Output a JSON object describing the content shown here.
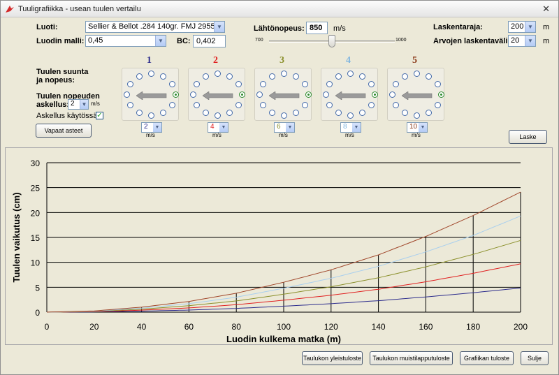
{
  "window": {
    "title": "Tuuligrafiikka - usean tuulen vertailu",
    "close": "✕"
  },
  "bullet": {
    "label": "Luoti:",
    "value": "Sellier & Bellot .284 140gr. FMJ  2955"
  },
  "model": {
    "label": "Luodin malli:",
    "value": "0,45"
  },
  "bc": {
    "label": "BC:",
    "value": "0,402"
  },
  "velocity": {
    "label": "Lähtönopeus:",
    "value": "850",
    "unit": "m/s",
    "min_label": "700",
    "max_label": "1000",
    "slider_fraction": 0.5
  },
  "calc_limit": {
    "label": "Laskentaraja:",
    "value": "200",
    "unit": "m"
  },
  "calc_step": {
    "label": "Arvojen laskentaväli:",
    "value": "20",
    "unit": "m"
  },
  "wind_dir_label_1": "Tuulen suunta",
  "wind_dir_label_2": "ja nopeus:",
  "step_label_1": "Tuulen nopeuden",
  "step_label_2": "askellus:",
  "step": {
    "value": "2",
    "unit": "m/s"
  },
  "step_enabled": {
    "label": "Askellus käytössä:",
    "checked": "✓"
  },
  "free_degrees_button": "Vapaat asteet",
  "calc_button": "Laske",
  "winds": [
    {
      "num": "1",
      "color": "#2b2b8c",
      "speed": "2",
      "unit": "m/s"
    },
    {
      "num": "2",
      "color": "#e02020",
      "speed": "4",
      "unit": "m/s"
    },
    {
      "num": "3",
      "color": "#8a8f2a",
      "speed": "6",
      "unit": "m/s"
    },
    {
      "num": "4",
      "color": "#7fb5e0",
      "speed": "8",
      "unit": "m/s"
    },
    {
      "num": "5",
      "color": "#8b3a1a",
      "speed": "10",
      "unit": "m/s"
    }
  ],
  "chart_data": {
    "type": "line",
    "ylabel": "Tuulen vaikutus (cm)",
    "xlabel": "Luodin kulkema matka (m)",
    "xlim": [
      0,
      200
    ],
    "ylim": [
      0,
      30
    ],
    "xticks": [
      0,
      20,
      40,
      60,
      80,
      100,
      120,
      140,
      160,
      180,
      200
    ],
    "yticks": [
      0,
      5,
      10,
      15,
      20,
      25,
      30
    ],
    "x": [
      0,
      20,
      40,
      60,
      80,
      100,
      120,
      140,
      160,
      180,
      200
    ],
    "series": [
      {
        "color": "#2b2b8c",
        "values": [
          0,
          0.05,
          0.2,
          0.42,
          0.75,
          1.2,
          1.7,
          2.3,
          3.05,
          3.9,
          4.85
        ]
      },
      {
        "color": "#e02020",
        "values": [
          0,
          0.1,
          0.4,
          0.85,
          1.5,
          2.4,
          3.4,
          4.6,
          6.1,
          7.8,
          9.7
        ]
      },
      {
        "color": "#8a8f2a",
        "values": [
          0,
          0.15,
          0.6,
          1.3,
          2.25,
          3.6,
          5.1,
          6.9,
          9.1,
          11.6,
          14.4
        ]
      },
      {
        "color": "#a9cfee",
        "values": [
          0,
          0.2,
          0.8,
          1.7,
          3.0,
          4.8,
          6.8,
          9.2,
          12.1,
          15.4,
          19.3
        ]
      },
      {
        "color": "#a0462a",
        "values": [
          0,
          0.25,
          1.0,
          2.15,
          3.8,
          6.0,
          8.5,
          11.5,
          15.2,
          19.4,
          24.1
        ]
      }
    ],
    "grid": "horizontal"
  },
  "bottom_buttons": [
    "Taulukon yleistuloste",
    "Taulukon muistilapputuloste",
    "Grafiikan tuloste",
    "Sulje"
  ]
}
